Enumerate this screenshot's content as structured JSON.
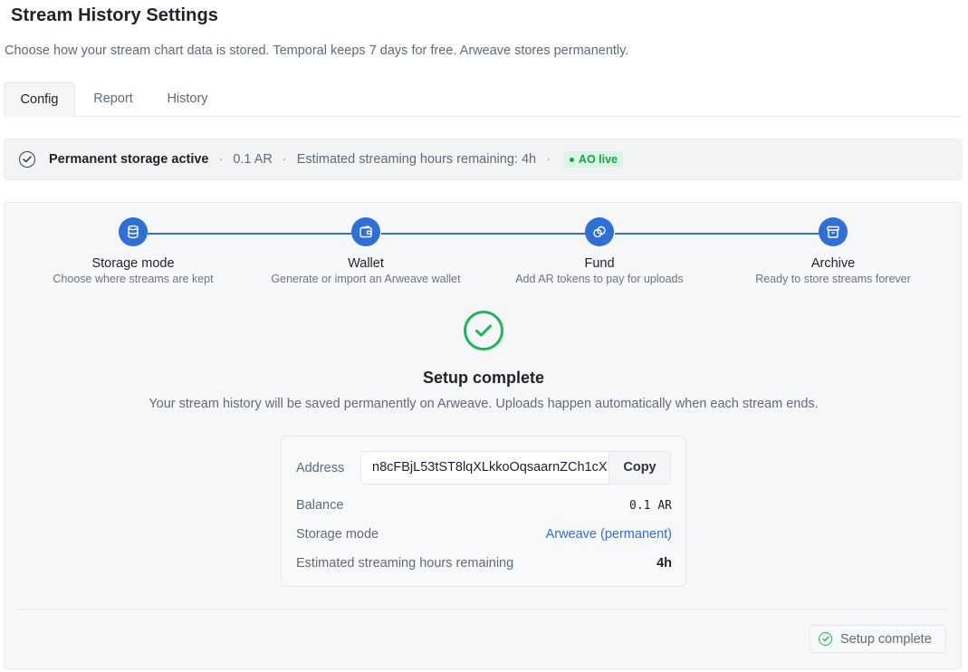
{
  "header": {
    "title": "Stream History Settings",
    "subtitle": "Choose how your stream chart data is stored. Temporal keeps 7 days for free. Arweave stores permanently."
  },
  "tabs": [
    {
      "label": "Config",
      "active": true
    },
    {
      "label": "Report",
      "active": false
    },
    {
      "label": "History",
      "active": false
    }
  ],
  "status": {
    "label": "Permanent storage active",
    "balance": "0.1 AR",
    "hours": "Estimated streaming hours remaining: 4h",
    "badge": "AO live",
    "separator": "·"
  },
  "steps": [
    {
      "title": "Storage mode",
      "desc": "Choose where streams are kept",
      "icon": "database-icon"
    },
    {
      "title": "Wallet",
      "desc": "Generate or import an Arweave wallet",
      "icon": "wallet-icon"
    },
    {
      "title": "Fund",
      "desc": "Add AR tokens to pay for uploads",
      "icon": "coins-icon"
    },
    {
      "title": "Archive",
      "desc": "Ready to store streams forever",
      "icon": "archive-icon"
    }
  ],
  "complete": {
    "title": "Setup complete",
    "desc": "Your stream history will be saved permanently on Arweave. Uploads happen automatically when each stream ends."
  },
  "info": {
    "address_label": "Address",
    "address_value": "n8cFBjL53tST8lqXLkkoOqsaarnZCh1cX",
    "copy_label": "Copy",
    "balance_label": "Balance",
    "balance_value": "0.1 AR",
    "mode_label": "Storage mode",
    "mode_value": "Arweave (permanent)",
    "hours_label": "Estimated streaming hours remaining",
    "hours_value": "4h"
  },
  "footer": {
    "button_label": "Setup complete"
  },
  "colors": {
    "accent": "#2f6fd6",
    "success": "#22b358",
    "badge_bg": "#d9f5e4"
  }
}
